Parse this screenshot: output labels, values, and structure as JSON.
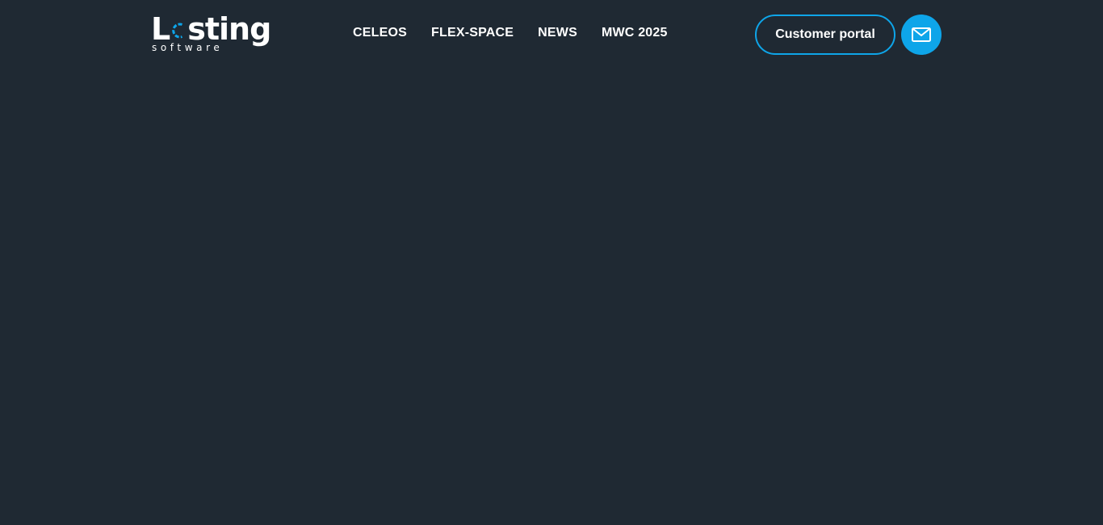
{
  "brand": {
    "name_prefix": "L",
    "name_suffix": "sting",
    "tagline": "software",
    "logo_icon": "logo-ring-icon",
    "accent_color": "#0ea5e9"
  },
  "nav": {
    "items": [
      {
        "label": "CELEOS"
      },
      {
        "label": "FLEX-SPACE"
      },
      {
        "label": "NEWS"
      },
      {
        "label": "MWC 2025"
      }
    ]
  },
  "header_actions": {
    "portal_label": "Customer portal",
    "mail_icon": "mail-icon"
  },
  "theme": {
    "background": "#1f2933",
    "text": "#ffffff",
    "accent": "#0ea5e9"
  }
}
